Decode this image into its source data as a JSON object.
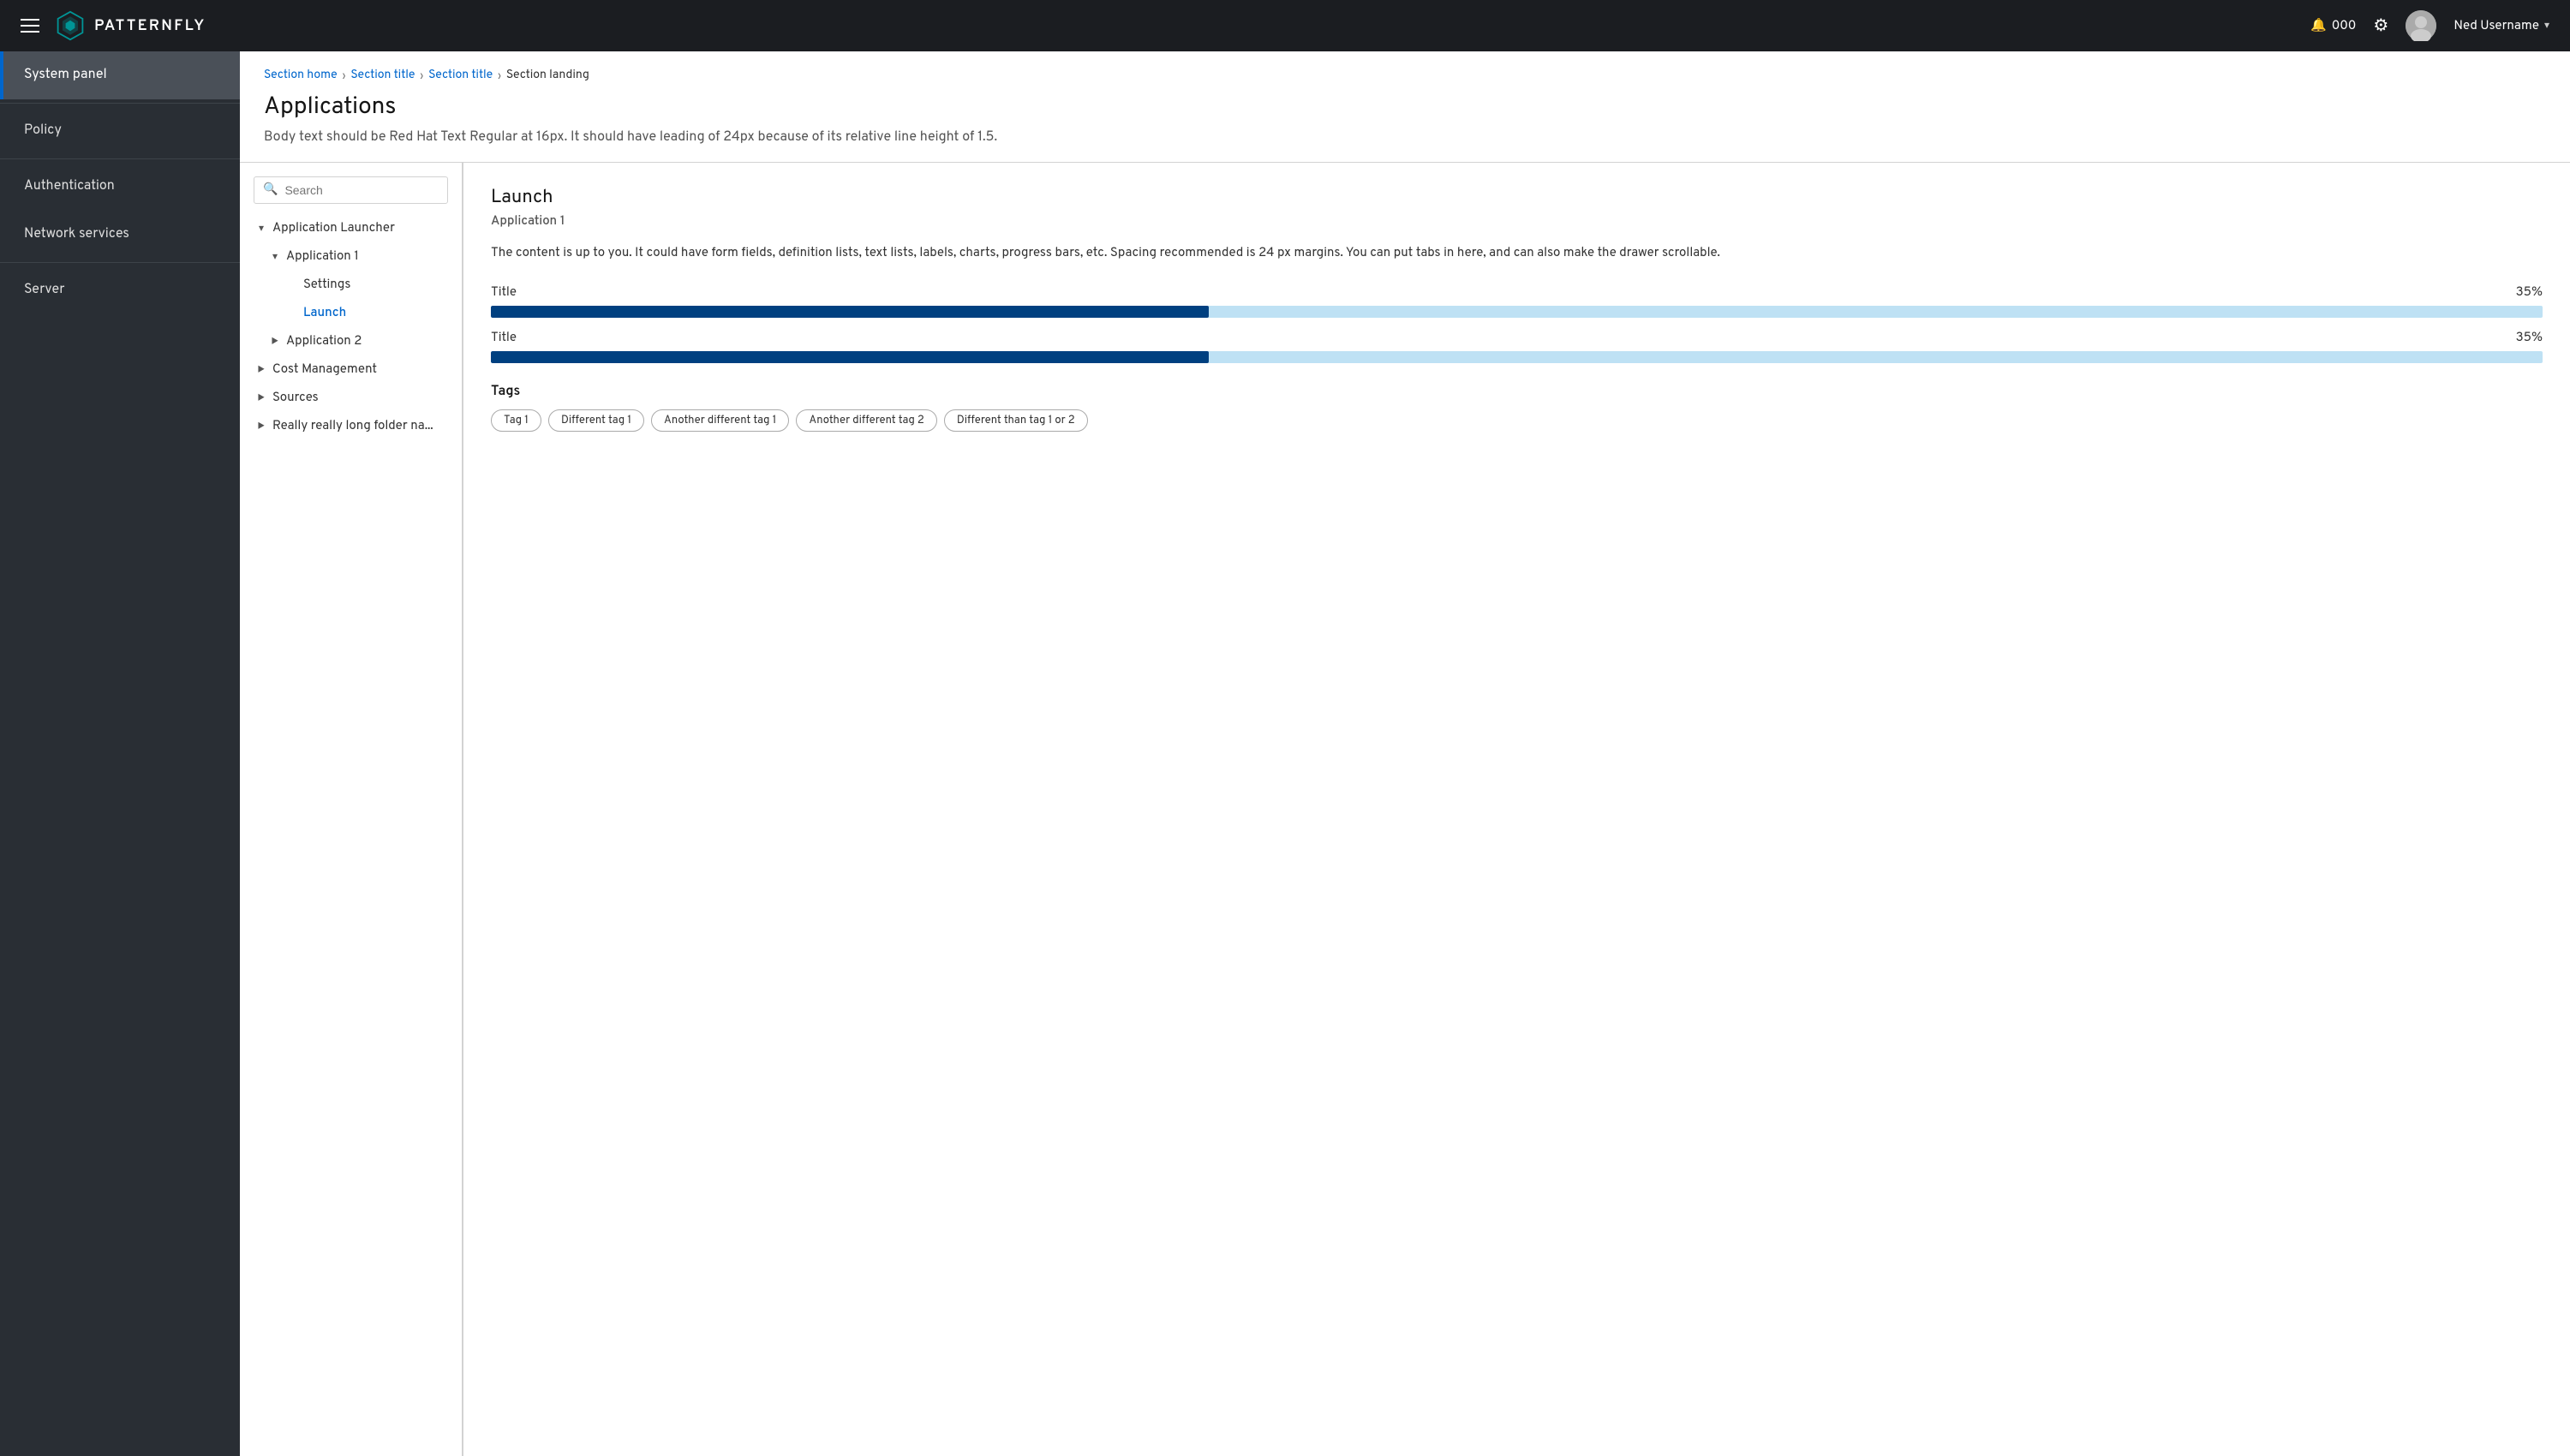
{
  "topnav": {
    "brand_name": "PATTERNFLY",
    "notification_count": "000",
    "user_name": "Ned Username"
  },
  "sidebar": {
    "items": [
      {
        "id": "system-panel",
        "label": "System panel",
        "active": true
      },
      {
        "id": "policy",
        "label": "Policy",
        "active": false
      },
      {
        "id": "authentication",
        "label": "Authentication",
        "active": false
      },
      {
        "id": "network-services",
        "label": "Network services",
        "active": false
      },
      {
        "id": "server",
        "label": "Server",
        "active": false
      }
    ]
  },
  "breadcrumb": {
    "items": [
      {
        "label": "Section home",
        "link": true
      },
      {
        "label": "Section title",
        "link": true
      },
      {
        "label": "Section title",
        "link": true
      },
      {
        "label": "Section landing",
        "link": false
      }
    ]
  },
  "page": {
    "title": "Applications",
    "subtitle": "Body text should be Red Hat Text Regular at 16px. It should have leading of 24px because of its relative line height of 1.5."
  },
  "search": {
    "placeholder": "Search"
  },
  "tree": [
    {
      "label": "Application Launcher",
      "indent": 0,
      "toggle": "▾",
      "expanded": true
    },
    {
      "label": "Application 1",
      "indent": 1,
      "toggle": "▾",
      "expanded": true
    },
    {
      "label": "Settings",
      "indent": 2,
      "toggle": "",
      "active": false
    },
    {
      "label": "Launch",
      "indent": 2,
      "toggle": "",
      "active": true
    },
    {
      "label": "Application 2",
      "indent": 1,
      "toggle": "▶",
      "expanded": false
    },
    {
      "label": "Cost Management",
      "indent": 0,
      "toggle": "▶",
      "expanded": false
    },
    {
      "label": "Sources",
      "indent": 0,
      "toggle": "▶",
      "expanded": false
    },
    {
      "label": "Really really long folder na...",
      "indent": 0,
      "toggle": "▶",
      "expanded": false
    }
  ],
  "detail": {
    "title": "Launch",
    "subtitle": "Application 1",
    "body": "The content is up to you. It could have form fields, definition lists, text lists, labels, charts, progress bars, etc. Spacing recommended is 24 px margins. You can put tabs in here, and can also make the drawer scrollable.",
    "progress_bars": [
      {
        "label": "Title",
        "value": 35,
        "display": "35%"
      },
      {
        "label": "Title",
        "value": 35,
        "display": "35%"
      }
    ],
    "tags_label": "Tags",
    "tags": [
      "Tag 1",
      "Different tag 1",
      "Another different tag 1",
      "Another different tag 2",
      "Different than tag 1 or 2"
    ]
  }
}
